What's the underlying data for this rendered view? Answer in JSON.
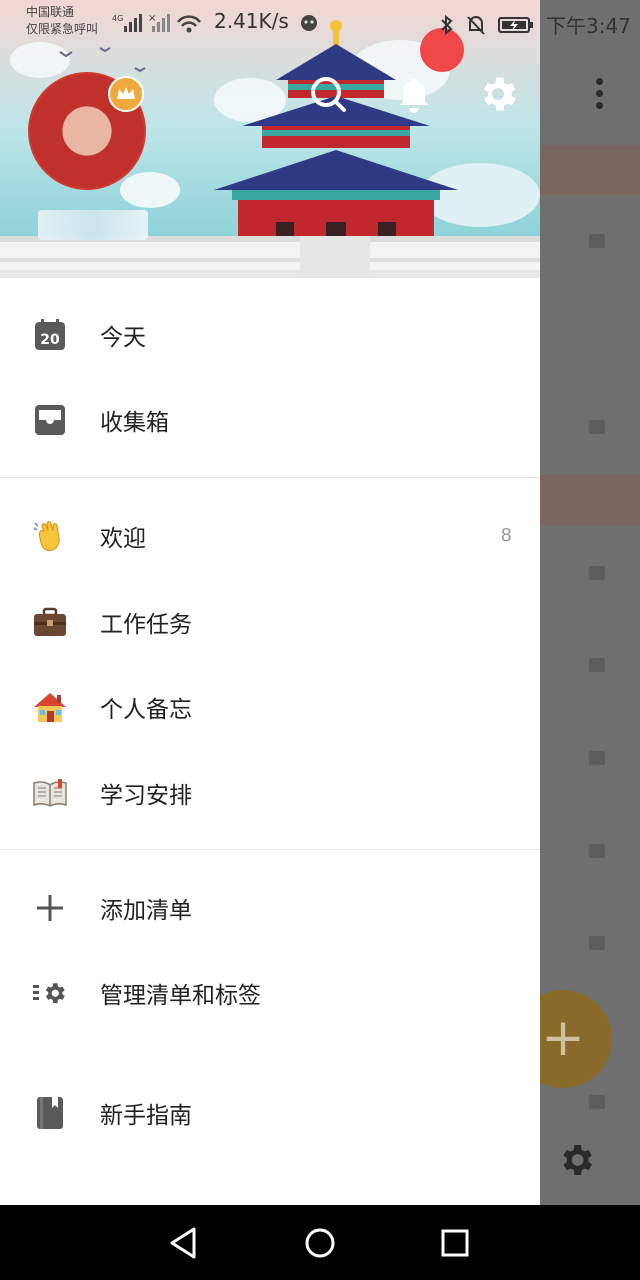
{
  "status_bar": {
    "carrier_line1": "中国联通",
    "carrier_line2": "仅限紧急呼叫",
    "network": "4G",
    "speed": "2.41K/s",
    "time": "下午3:47"
  },
  "header": {
    "icons": [
      "search-icon",
      "bell-icon",
      "settings-icon"
    ],
    "colors": {
      "sky": "#8fd3dc",
      "temple_red": "#c0282d",
      "roof_blue": "#2f3a84",
      "notification_dot": "#f04848"
    }
  },
  "menu": {
    "top_items": [
      {
        "label": "今天",
        "icon": "calendar-icon",
        "icon_text": "20"
      },
      {
        "label": "收集箱",
        "icon": "inbox-icon"
      }
    ],
    "lists": [
      {
        "label": "欢迎",
        "icon": "waving-hand-icon",
        "count": "8"
      },
      {
        "label": "工作任务",
        "icon": "briefcase-icon"
      },
      {
        "label": "个人备忘",
        "icon": "house-icon"
      },
      {
        "label": "学习安排",
        "icon": "book-icon"
      }
    ],
    "add_list": "添加清单",
    "manage": "管理清单和标签",
    "guide": "新手指南"
  },
  "nav_bar": {
    "buttons": [
      "back-icon",
      "home-icon",
      "recents-icon"
    ]
  }
}
